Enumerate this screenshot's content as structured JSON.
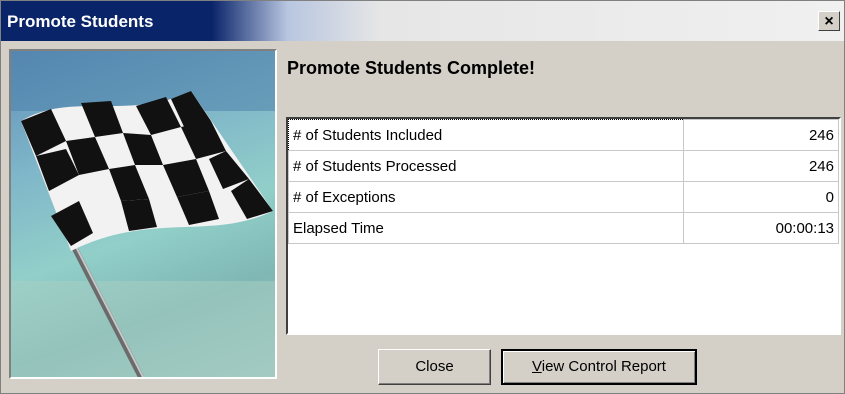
{
  "window": {
    "title": "Promote Students",
    "close_glyph": "×"
  },
  "picture": {
    "icon": "checkered-flag-icon"
  },
  "heading": "Promote Students Complete!",
  "rows": [
    {
      "label": "# of Students Included",
      "value": "246"
    },
    {
      "label": "# of Students Processed",
      "value": "246"
    },
    {
      "label": "# of Exceptions",
      "value": "0"
    },
    {
      "label": "Elapsed Time",
      "value": "00:00:13"
    }
  ],
  "buttons": {
    "close": "Close",
    "report_mnemonic": "V",
    "report_rest": "iew Control Report"
  }
}
